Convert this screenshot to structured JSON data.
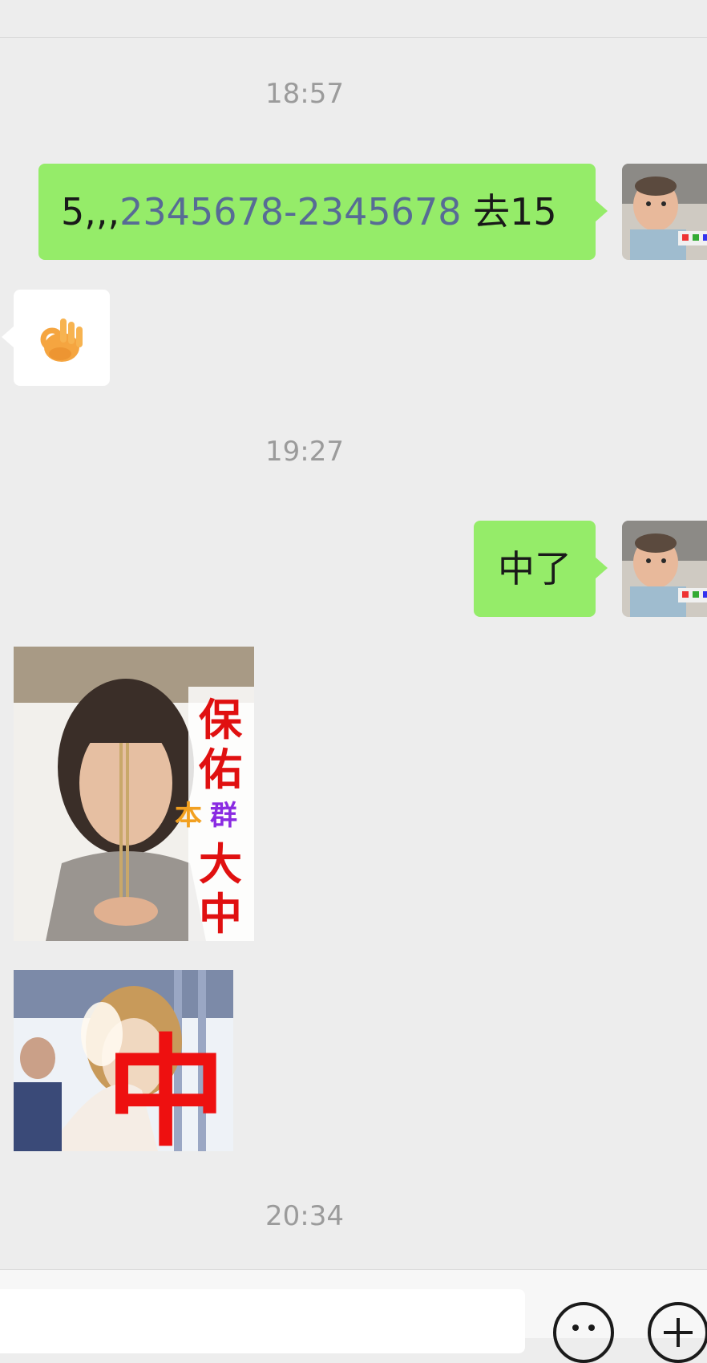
{
  "messages": {
    "time_1": "18:57",
    "msg_1": {
      "part_a": "5,,,",
      "phone": "2345678-2345678",
      "part_b": " 去15"
    },
    "reply_ok_icon": "ok-hand-emoji",
    "time_2": "19:27",
    "msg_2": "中了",
    "sticker_1": {
      "text_lines": [
        "保",
        "佑",
        "大",
        "中"
      ],
      "colored_text": [
        "本",
        "群"
      ]
    },
    "sticker_2": {
      "text": "中"
    },
    "time_3": "20:34"
  },
  "input_bar": {
    "emoji_icon": "smiley-face-icon",
    "more_icon": "plus-circle-icon"
  },
  "colors": {
    "background": "#ededed",
    "my_bubble": "#95ec69",
    "their_bubble": "#ffffff",
    "link": "#576b95",
    "timestamp": "#9b9b9b"
  }
}
